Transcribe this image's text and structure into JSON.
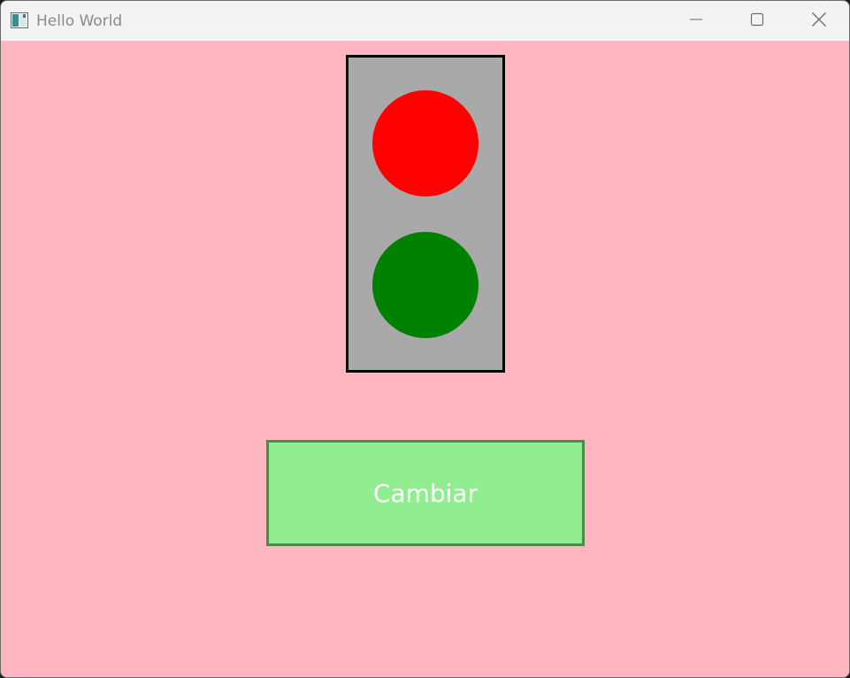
{
  "window": {
    "title": "Hello World",
    "background_color": "#ffb6c1",
    "titlebar_color": "#f3f3f3",
    "controls": {
      "minimize_icon": "minimize-icon",
      "maximize_icon": "maximize-icon",
      "close_icon": "close-icon"
    }
  },
  "traffic_light": {
    "housing_color": "#a9a9a9",
    "border_color": "#000000",
    "lamps": [
      {
        "name": "red",
        "color": "#ff0000"
      },
      {
        "name": "green",
        "color": "#008000"
      }
    ]
  },
  "button": {
    "label": "Cambiar",
    "background_color": "#90ee90",
    "text_color": "#ffffff"
  }
}
